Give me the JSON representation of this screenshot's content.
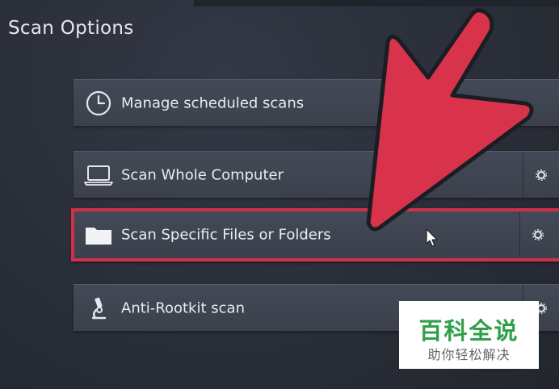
{
  "page": {
    "title": "Scan Options"
  },
  "options": [
    {
      "label": "Manage scheduled scans",
      "icon": "clock-icon",
      "has_settings": false
    },
    {
      "label": "Scan Whole Computer",
      "icon": "laptop-icon",
      "has_settings": true
    },
    {
      "label": "Scan Specific Files or Folders",
      "icon": "folder-icon",
      "has_settings": true,
      "highlighted": true
    },
    {
      "label": "Anti-Rootkit scan",
      "icon": "microscope-icon",
      "has_settings": true
    }
  ],
  "watermark": {
    "title": "百科全说",
    "subtitle": "助你轻松解决"
  },
  "colors": {
    "highlight": "#d0304a",
    "arrow": "#d8334a",
    "watermark_green": "#2fa04a"
  }
}
